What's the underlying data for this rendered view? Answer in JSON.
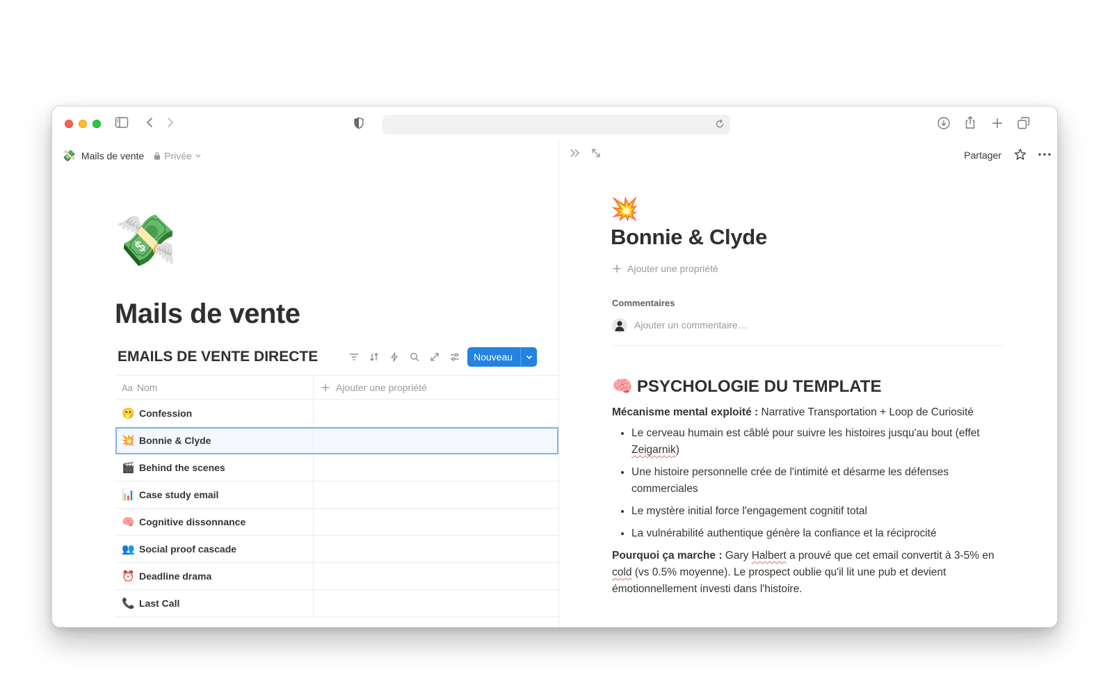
{
  "browser": {
    "url": "",
    "icons": [
      "sidebar-icon",
      "back-icon",
      "forward-icon",
      "shield-icon",
      "reload-icon",
      "download-icon",
      "share-icon",
      "new-tab-icon",
      "tabs-icon"
    ]
  },
  "left": {
    "breadcrumb": {
      "emoji": "💸",
      "title": "Mails de vente",
      "privacy": "Privée"
    },
    "hero_emoji": "💸",
    "page_title": "Mails de vente",
    "database": {
      "title": "EMAILS DE VENTE DIRECTE",
      "new_button": "Nouveau",
      "columns": {
        "name_icon": "Aa",
        "name": "Nom",
        "add_property": "Ajouter une propriété"
      },
      "rows": [
        {
          "emoji": "🫢",
          "name": "Confession"
        },
        {
          "emoji": "💥",
          "name": "Bonnie & Clyde"
        },
        {
          "emoji": "🎬",
          "name": "Behind the scenes"
        },
        {
          "emoji": "📊",
          "name": "Case study email"
        },
        {
          "emoji": "🧠",
          "name": "Cognitive dissonnance"
        },
        {
          "emoji": "👥",
          "name": "Social proof cascade"
        },
        {
          "emoji": "⏰",
          "name": "Deadline drama"
        },
        {
          "emoji": "📞",
          "name": "Last Call"
        }
      ],
      "selected_row": "Bonnie & Clyde"
    }
  },
  "right": {
    "share": "Partager",
    "emoji": "💥",
    "title": "Bonnie & Clyde",
    "add_property": "Ajouter une propriété",
    "comments_label": "Commentaires",
    "comment_placeholder": "Ajouter un commentaire…",
    "section": {
      "emoji": "🧠",
      "heading": "PSYCHOLOGIE DU TEMPLATE",
      "mechanism_label": "Mécanisme mental exploité :",
      "mechanism_value": " Narrative Transportation + Loop de Curiosité",
      "bullets": [
        "Le cerveau humain est câblé pour suivre les histoires jusqu'au bout (effet Zeigarnik)",
        "Une histoire personnelle crée de l'intimité et désarme les défenses commerciales",
        "Le mystère initial force l'engagement cognitif total",
        "La vulnérabilité authentique génère la confiance et la réciprocité"
      ],
      "why_label": "Pourquoi ça marche :",
      "why_value": " Gary Halbert a prouvé que cet email convertit à 3-5% en cold (vs 0.5% moyenne). Le prospect oublie qu'il lit une pub et devient émotionnellement investi dans l'histoire."
    }
  }
}
